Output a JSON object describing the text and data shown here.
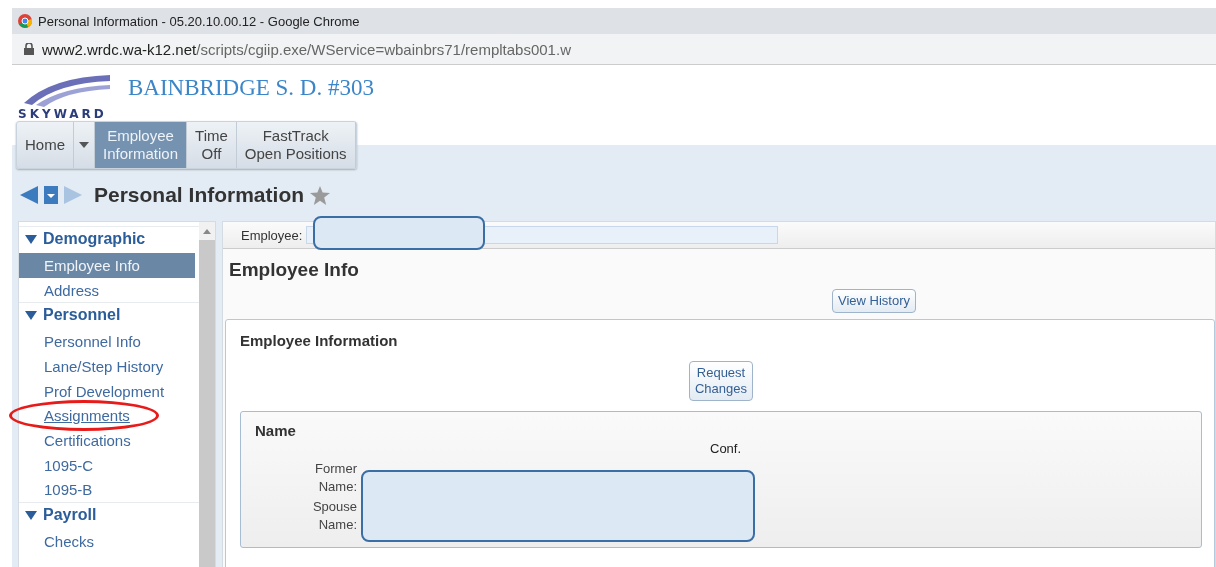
{
  "browser": {
    "title": "Personal Information - 05.20.10.00.12 - Google Chrome",
    "url_host": "www2.wrdc.wa-k12.net",
    "url_path": "/scripts/cgiip.exe/WService=wbainbrs71/rempltabs001.w"
  },
  "header": {
    "logo": "SKYWARD",
    "district": "BAINBRIDGE S. D. #303"
  },
  "nav_tabs": [
    {
      "label": "Home",
      "selected": false,
      "dropdown": true
    },
    {
      "label": "Employee\nInformation",
      "selected": true,
      "dropdown": false
    },
    {
      "label": "Time\nOff",
      "selected": false,
      "dropdown": false
    },
    {
      "label": "FastTrack\nOpen Positions",
      "selected": false,
      "dropdown": false
    }
  ],
  "page_title": "Personal Information",
  "sidebar": {
    "sections": [
      {
        "title": "Demographic",
        "expanded": true,
        "items": [
          {
            "label": "Employee Info",
            "selected": true,
            "annotated": false
          },
          {
            "label": "Address",
            "selected": false,
            "annotated": false
          }
        ]
      },
      {
        "title": "Personnel",
        "expanded": true,
        "items": [
          {
            "label": "Personnel Info",
            "selected": false,
            "annotated": false
          },
          {
            "label": "Lane/Step History",
            "selected": false,
            "annotated": false
          },
          {
            "label": "Prof Development",
            "selected": false,
            "annotated": false
          },
          {
            "label": "Assignments",
            "selected": false,
            "annotated": true
          },
          {
            "label": "Certifications",
            "selected": false,
            "annotated": false
          },
          {
            "label": "1095-C",
            "selected": false,
            "annotated": false
          },
          {
            "label": "1095-B",
            "selected": false,
            "annotated": false
          }
        ]
      },
      {
        "title": "Payroll",
        "expanded": true,
        "items": [
          {
            "label": "Checks",
            "selected": false,
            "annotated": false
          }
        ]
      }
    ]
  },
  "employee_label": "Employee:",
  "section_title": "Employee Info",
  "view_history_button": "View History",
  "panel": {
    "title": "Employee Information",
    "request_button": "Request\nChanges",
    "name_group": {
      "title": "Name",
      "conf_label": "Conf.",
      "fields": [
        "Former\nName:",
        "Spouse\nName:"
      ]
    }
  }
}
